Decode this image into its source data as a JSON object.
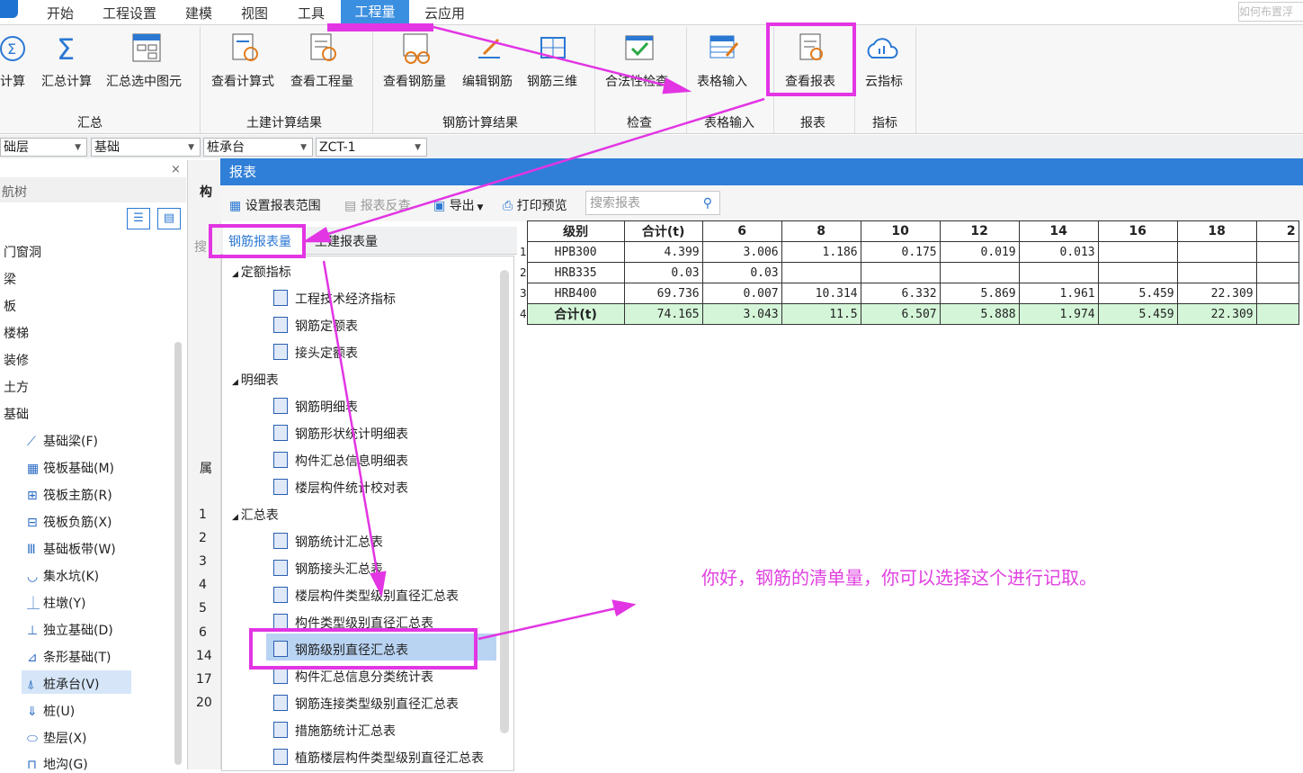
{
  "menubar": {
    "items": [
      "开始",
      "工程设置",
      "建模",
      "视图",
      "工具",
      "工程量",
      "云应用"
    ],
    "active": "工程量",
    "help_placeholder": "如何布置浮"
  },
  "ribbon": {
    "buttons": [
      "计算",
      "汇总计算",
      "汇总选中图元",
      "查看计算式",
      "查看工程量",
      "查看钢筋量",
      "编辑钢筋",
      "钢筋三维",
      "合法性检查",
      "表格输入",
      "查看报表",
      "云指标"
    ],
    "groups": [
      "汇总",
      "土建计算结果",
      "钢筋计算结果",
      "检查",
      "表格输入",
      "报表",
      "指标"
    ]
  },
  "combos": [
    "础层",
    "基础",
    "桩承台",
    "ZCT-1"
  ],
  "leftnav": {
    "title": "航树",
    "categories": [
      "门窗洞",
      "梁",
      "板",
      "楼梯",
      "装修",
      "土方",
      "基础"
    ],
    "items": [
      "基础梁(F)",
      "筏板基础(M)",
      "筏板主筋(R)",
      "筏板负筋(X)",
      "基础板带(W)",
      "集水坑(K)",
      "柱墩(Y)",
      "独立基础(D)",
      "条形基础(T)",
      "桩承台(V)",
      "桩(U)",
      "垫层(X)",
      "地沟(G)"
    ],
    "selected": "桩承台(V)"
  },
  "midpanel": {
    "labels": [
      "构",
      "搜",
      "属"
    ],
    "rows": [
      "1",
      "2",
      "3",
      "4",
      "5",
      "6",
      "14",
      "17",
      "20"
    ]
  },
  "dialog": {
    "title": "报表",
    "toolbar": {
      "set_range": "设置报表范围",
      "reverse_check": "报表反查",
      "export": "导出",
      "print_preview": "打印预览",
      "search_placeholder": "搜索报表"
    },
    "tabs": [
      "钢筋报表量",
      "土建报表量"
    ],
    "tree": {
      "groups": [
        {
          "label": "定额指标",
          "items": [
            "工程技术经济指标",
            "钢筋定额表",
            "接头定额表"
          ]
        },
        {
          "label": "明细表",
          "items": [
            "钢筋明细表",
            "钢筋形状统计明细表",
            "构件汇总信息明细表",
            "楼层构件统计校对表"
          ]
        },
        {
          "label": "汇总表",
          "items": [
            "钢筋统计汇总表",
            "钢筋接头汇总表",
            "楼层构件类型级别直径汇总表",
            "构件类型级别直径汇总表",
            "钢筋级别直径汇总表",
            "构件汇总信息分类统计表",
            "钢筋连接类型级别直径汇总表",
            "措施筋统计汇总表",
            "植筋楼层构件类型级别直径汇总表"
          ]
        }
      ],
      "selected": "钢筋级别直径汇总表"
    }
  },
  "report_table": {
    "headers": [
      "级别",
      "合计(t)",
      "6",
      "8",
      "10",
      "12",
      "14",
      "16",
      "18",
      "2"
    ],
    "rows": [
      {
        "n": "1",
        "cells": [
          "HPB300",
          "4.399",
          "3.006",
          "1.186",
          "0.175",
          "0.019",
          "0.013",
          "",
          "",
          ""
        ]
      },
      {
        "n": "2",
        "cells": [
          "HRB335",
          "0.03",
          "0.03",
          "",
          "",
          "",
          "",
          "",
          "",
          ""
        ]
      },
      {
        "n": "3",
        "cells": [
          "HRB400",
          "69.736",
          "0.007",
          "10.314",
          "6.332",
          "5.869",
          "1.961",
          "5.459",
          "22.309",
          ""
        ]
      },
      {
        "n": "4",
        "cells": [
          "合计(t)",
          "74.165",
          "3.043",
          "11.5",
          "6.507",
          "5.888",
          "1.974",
          "5.459",
          "22.309",
          ""
        ]
      }
    ]
  },
  "annotation": {
    "text": "你好，钢筋的清单量，你可以选择这个进行记取。",
    "color": "#e235e3"
  }
}
